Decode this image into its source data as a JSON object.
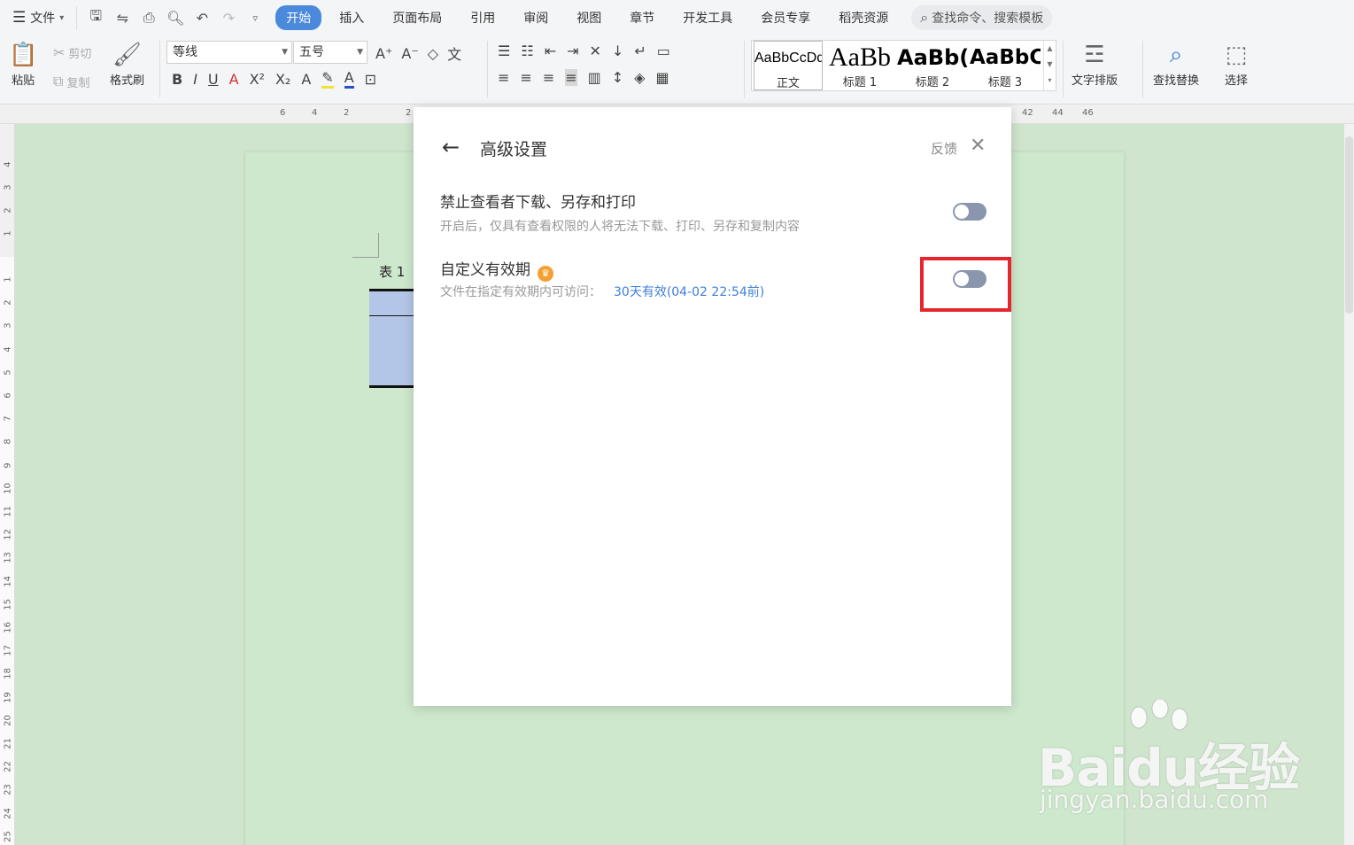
{
  "menu": {
    "file_label": "文件",
    "tabs": [
      "开始",
      "插入",
      "页面布局",
      "引用",
      "审阅",
      "视图",
      "章节",
      "开发工具",
      "会员专享",
      "稻壳资源"
    ],
    "search_placeholder": "查找命令、搜索模板"
  },
  "ribbon": {
    "paste": "粘贴",
    "cut": "剪切",
    "copy": "复制",
    "format_painter": "格式刷",
    "font_name": "等线",
    "font_size": "五号",
    "styles": [
      {
        "sample": "AaBbCcDd",
        "label": "正文"
      },
      {
        "sample": "AaBb",
        "label": "标题 1"
      },
      {
        "sample": "AaBb(",
        "label": "标题 2"
      },
      {
        "sample": "AaBbC",
        "label": "标题 3"
      }
    ],
    "text_layout": "文字排版",
    "find_replace": "查找替换",
    "select": "选择"
  },
  "ruler": {
    "h_ticks": [
      "6",
      "4",
      "2",
      "2",
      "42",
      "44",
      "46"
    ],
    "v_ticks": [
      "4",
      "3",
      "2",
      "1",
      "1",
      "2",
      "3",
      "4",
      "5",
      "6",
      "7",
      "8",
      "9",
      "10",
      "11",
      "12",
      "13",
      "14",
      "15",
      "16",
      "17",
      "18",
      "19",
      "20",
      "21",
      "22",
      "23",
      "24",
      "25"
    ]
  },
  "document": {
    "table_label": "表 1"
  },
  "dialog": {
    "title": "高级设置",
    "feedback": "反馈",
    "options": [
      {
        "title": "禁止查看者下载、另存和打印",
        "desc": "开启后，仅具有查看权限的人将无法下载、打印、另存和复制内容",
        "enabled": false
      },
      {
        "title": "自定义有效期",
        "desc": "文件在指定有效期内可访问：",
        "link": "30天有效(04-02 22:54前)",
        "enabled": false
      }
    ]
  },
  "watermark": {
    "brand": "Baidu经验",
    "url": "jingyan.baidu.com"
  },
  "colors": {
    "accent": "#4a89dc",
    "toggle_off": "#8a96ad",
    "highlight_box": "#e5262d",
    "link": "#3e7fd8",
    "page_bg": "#cfe5cd"
  }
}
